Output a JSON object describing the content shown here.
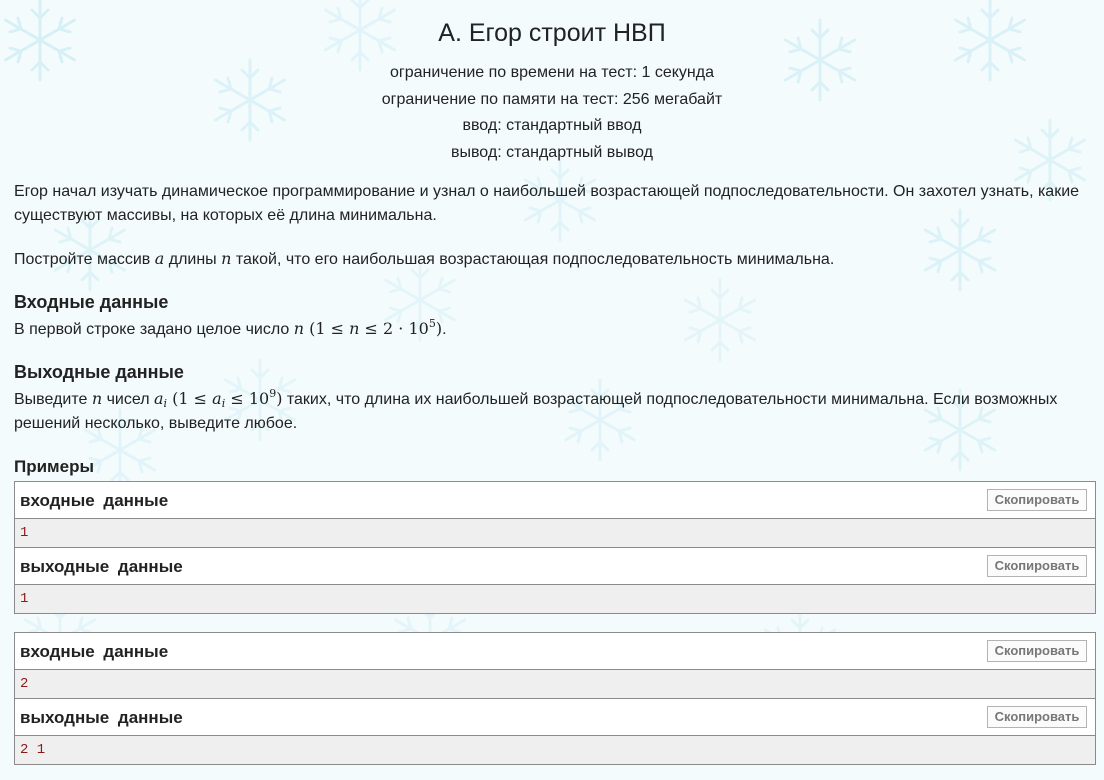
{
  "problem": {
    "title": "A. Егор строит НВП",
    "time_limit": "ограничение по времени на тест: 1 секунда",
    "memory_limit": "ограничение по памяти на тест: 256 мегабайт",
    "input_spec": "ввод: стандартный ввод",
    "output_spec": "вывод: стандартный вывод"
  },
  "statement": {
    "para1": "Егор начал изучать динамическое программирование и узнал о наибольшей возрастающей подпоследовательности. Он захотел узнать, какие существуют массивы, на которых её длина минимальна.",
    "para2_a": "Постройте массив ",
    "para2_var_a": "a",
    "para2_b": " длины ",
    "para2_var_n": "n",
    "para2_c": " такой, что его наибольшая возрастающая подпоследовательность минимальна."
  },
  "input_section": {
    "title": "Входные данные",
    "text_a": "В первой строке задано целое число ",
    "var_n": "n",
    "constraint_open": " (1 ≤ ",
    "constraint_var": "n",
    "constraint_mid": " ≤ 2 · 10",
    "constraint_exp": "5",
    "constraint_close": ")",
    "text_end": "."
  },
  "output_section": {
    "title": "Выходные данные",
    "text_a": "Выведите ",
    "var_n": "n",
    "text_b": " чисел ",
    "var_a": "a",
    "var_a_sub": "i",
    "constraint_open": " (1 ≤ ",
    "constraint_var": "a",
    "constraint_var_sub": "i",
    "constraint_mid": " ≤ 10",
    "constraint_exp": "9",
    "constraint_close": ")",
    "text_c": " таких, что длина их наибольшей возрастающей подпоследовательности минимальна. Если возможных решений несколько, выведите любое."
  },
  "examples": {
    "title": "Примеры",
    "copy_label": "Скопировать",
    "items": [
      {
        "input_label": "входные данные",
        "input_value": "1",
        "output_label": "выходные данные",
        "output_value": "1"
      },
      {
        "input_label": "входные данные",
        "input_value": "2",
        "output_label": "выходные данные",
        "output_value": "2 1"
      }
    ]
  },
  "colors": {
    "background": "#f4fbfd",
    "snowflake": "#bfe9f2",
    "sample_value": "#8b1a1a",
    "border": "#8b8b8b"
  }
}
